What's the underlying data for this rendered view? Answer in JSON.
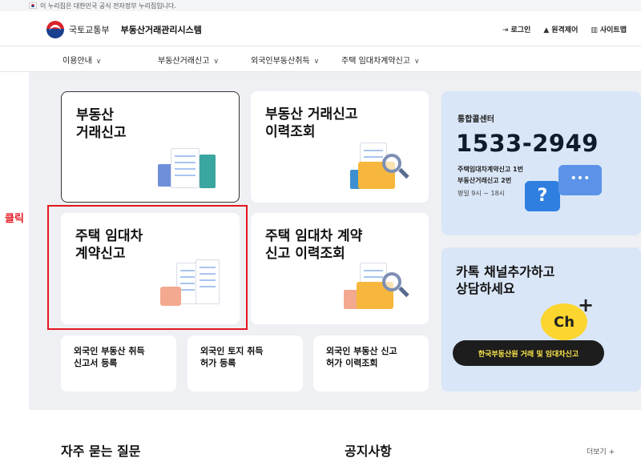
{
  "gov_banner": {
    "text": "이 누리집은 대한민국 공식 전자정부 누리집입니다."
  },
  "header": {
    "ministry": "국토교통부",
    "system": "부동산거래관리시스템",
    "util": [
      {
        "icon": "login-icon",
        "glyph": "⇥",
        "label": "로그인"
      },
      {
        "icon": "cursor-icon",
        "glyph": "▲",
        "label": "원격제어"
      },
      {
        "icon": "sitemap-icon",
        "glyph": "▥",
        "label": "사이트맵"
      }
    ]
  },
  "nav": [
    {
      "label": "이용안내"
    },
    {
      "label": "부동산거래신고"
    },
    {
      "label": "외국인부동산취득"
    },
    {
      "label": "주택 임대차계약신고"
    }
  ],
  "cards": {
    "c1": {
      "line1": "부동산",
      "line2": "거래신고"
    },
    "c2": {
      "line1": "부동산 거래신고",
      "line2": "이력조회"
    },
    "c3": {
      "line1": "주택 임대차",
      "line2": "계약신고"
    },
    "c4": {
      "line1": "주택 임대차 계약",
      "line2": "신고 이력조회"
    },
    "s1": {
      "line1": "외국인 부동산 취득",
      "line2": "신고서 등록"
    },
    "s2": {
      "line1": "외국인 토지 취득",
      "line2": "허가 등록"
    },
    "s3": {
      "line1": "외국인 부동산 신고",
      "line2": "허가 이력조회"
    }
  },
  "annotation": {
    "label": "클릭",
    "color": "#e4161f"
  },
  "callcenter": {
    "title": "통합콜센터",
    "phone": "1533-2949",
    "line1": "주택임대차계약신고 1번",
    "line2": "부동산거래신고 2번",
    "hours": "평일 9시 ~ 18시"
  },
  "kakao": {
    "line1": "카톡 채널추가하고",
    "line2": "상담하세요",
    "badge": "Ch",
    "button": "한국부동산원 거래 및 임대차신고"
  },
  "bottom": {
    "faq": "자주 묻는 질문",
    "notice": "공지사항",
    "more": "더보기 +"
  },
  "colors": {
    "accent": "#1b3f8f",
    "annotation": "#e4161f",
    "kakao_yellow": "#fdd52f",
    "panel_blue": "#d9e6f7"
  }
}
